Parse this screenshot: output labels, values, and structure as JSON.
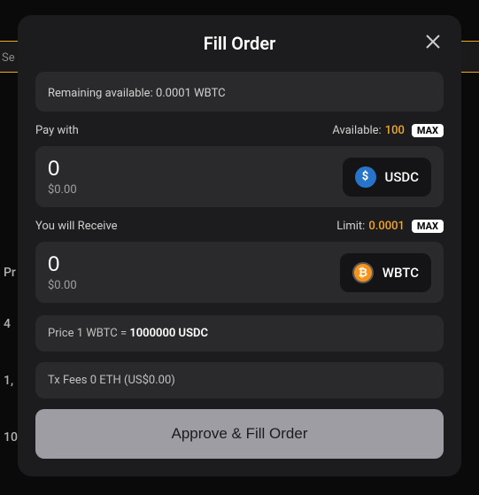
{
  "modal": {
    "title": "Fill Order",
    "remaining": "Remaining available: 0.0001 WBTC"
  },
  "pay": {
    "label": "Pay with",
    "available_label": "Available:",
    "available_value": "100",
    "max": "MAX",
    "amount": "0",
    "usd": "$0.00",
    "token": "USDC",
    "token_glyph": "$"
  },
  "receive": {
    "label": "You will Receive",
    "limit_label": "Limit:",
    "limit_value": "0.0001",
    "max": "MAX",
    "amount": "0",
    "usd": "$0.00",
    "token": "WBTC",
    "token_glyph": "₿"
  },
  "price": {
    "prefix": "Price 1 WBTC = ",
    "value": "1000000 USDC"
  },
  "fees": {
    "text": "Tx Fees 0 ETH (US$0.00)"
  },
  "action": {
    "label": "Approve & Fill Order"
  },
  "bg": {
    "search_hint": "Se",
    "t1": "Pr",
    "t2": "4",
    "t3": "1,",
    "t4": "10"
  }
}
